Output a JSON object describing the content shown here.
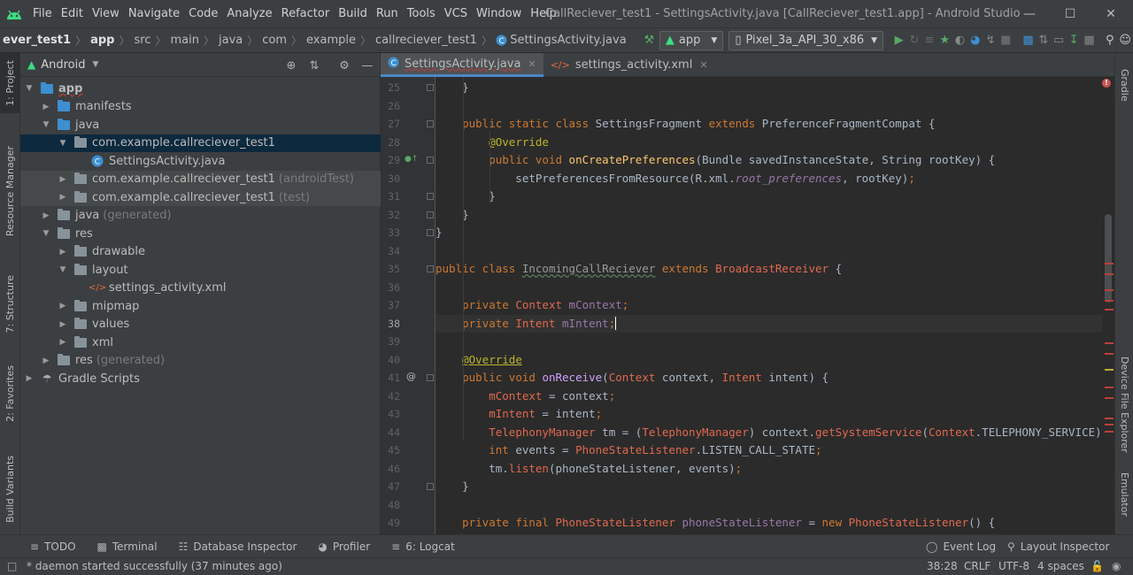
{
  "menubar": {
    "items": [
      "File",
      "Edit",
      "View",
      "Navigate",
      "Code",
      "Analyze",
      "Refactor",
      "Build",
      "Run",
      "Tools",
      "VCS",
      "Window",
      "Help"
    ],
    "title": "CallReciever_test1 - SettingsActivity.java [CallReciever_test1.app] - Android Studio",
    "window_controls": [
      "minimize-icon",
      "maximize-icon",
      "close-icon"
    ]
  },
  "navbar": {
    "breadcrumbs": [
      "ever_test1",
      "app",
      "src",
      "main",
      "java",
      "com",
      "example",
      "callreciever_test1",
      "SettingsActivity.java"
    ],
    "run_config": "app",
    "device": "Pixel_3a_API_30_x86"
  },
  "left_tabs": [
    "1: Project",
    "Resource Manager",
    "7: Structure",
    "2: Favorites",
    "Build Variants"
  ],
  "right_tabs": [
    "Gradle",
    "Device File Explorer",
    "Emulator"
  ],
  "project": {
    "view_mode": "Android",
    "tree": [
      {
        "label": "app",
        "note": "",
        "depth": 0,
        "expanded": true,
        "icon": "module"
      },
      {
        "label": "manifests",
        "note": "",
        "depth": 1,
        "expanded": false,
        "icon": "folder-blue"
      },
      {
        "label": "java",
        "note": "",
        "depth": 1,
        "expanded": true,
        "icon": "folder-blue"
      },
      {
        "label": "com.example.callreciever_test1",
        "note": "",
        "depth": 2,
        "expanded": true,
        "icon": "package"
      },
      {
        "label": "SettingsActivity.java",
        "note": "",
        "depth": 3,
        "expanded": false,
        "icon": "class"
      },
      {
        "label": "com.example.callreciever_test1",
        "note": "(androidTest)",
        "depth": 2,
        "expanded": false,
        "icon": "package"
      },
      {
        "label": "com.example.callreciever_test1",
        "note": "(test)",
        "depth": 2,
        "expanded": false,
        "icon": "package"
      },
      {
        "label": "java",
        "note": "(generated)",
        "depth": 1,
        "expanded": false,
        "icon": "folder-gen"
      },
      {
        "label": "res",
        "note": "",
        "depth": 1,
        "expanded": true,
        "icon": "folder-res"
      },
      {
        "label": "drawable",
        "note": "",
        "depth": 2,
        "expanded": false,
        "icon": "folder"
      },
      {
        "label": "layout",
        "note": "",
        "depth": 2,
        "expanded": true,
        "icon": "folder"
      },
      {
        "label": "settings_activity.xml",
        "note": "",
        "depth": 3,
        "expanded": false,
        "icon": "xml"
      },
      {
        "label": "mipmap",
        "note": "",
        "depth": 2,
        "expanded": false,
        "icon": "folder"
      },
      {
        "label": "values",
        "note": "",
        "depth": 2,
        "expanded": false,
        "icon": "folder"
      },
      {
        "label": "xml",
        "note": "",
        "depth": 2,
        "expanded": false,
        "icon": "folder"
      },
      {
        "label": "res",
        "note": "(generated)",
        "depth": 1,
        "expanded": false,
        "icon": "folder-gen"
      },
      {
        "label": "Gradle Scripts",
        "note": "",
        "depth": 0,
        "expanded": false,
        "icon": "gradle"
      }
    ]
  },
  "editor": {
    "tabs": [
      "SettingsActivity.java",
      "settings_activity.xml"
    ],
    "line_numbers": [
      "25",
      "26",
      "27",
      "28",
      "29",
      "30",
      "31",
      "32",
      "33",
      "34",
      "35",
      "36",
      "37",
      "38",
      "39",
      "40",
      "41",
      "42",
      "43",
      "44",
      "45",
      "46",
      "47",
      "48",
      "49"
    ],
    "current_line": "38"
  },
  "bottom_tools": [
    "TODO",
    "Terminal",
    "Database Inspector",
    "Profiler",
    "6: Logcat"
  ],
  "bottom_right_tools": [
    "Event Log",
    "Layout Inspector"
  ],
  "status": {
    "message": "* daemon started successfully (37 minutes ago)",
    "position": "38:28",
    "line_sep": "CRLF",
    "encoding": "UTF-8",
    "indent": "4 spaces"
  }
}
